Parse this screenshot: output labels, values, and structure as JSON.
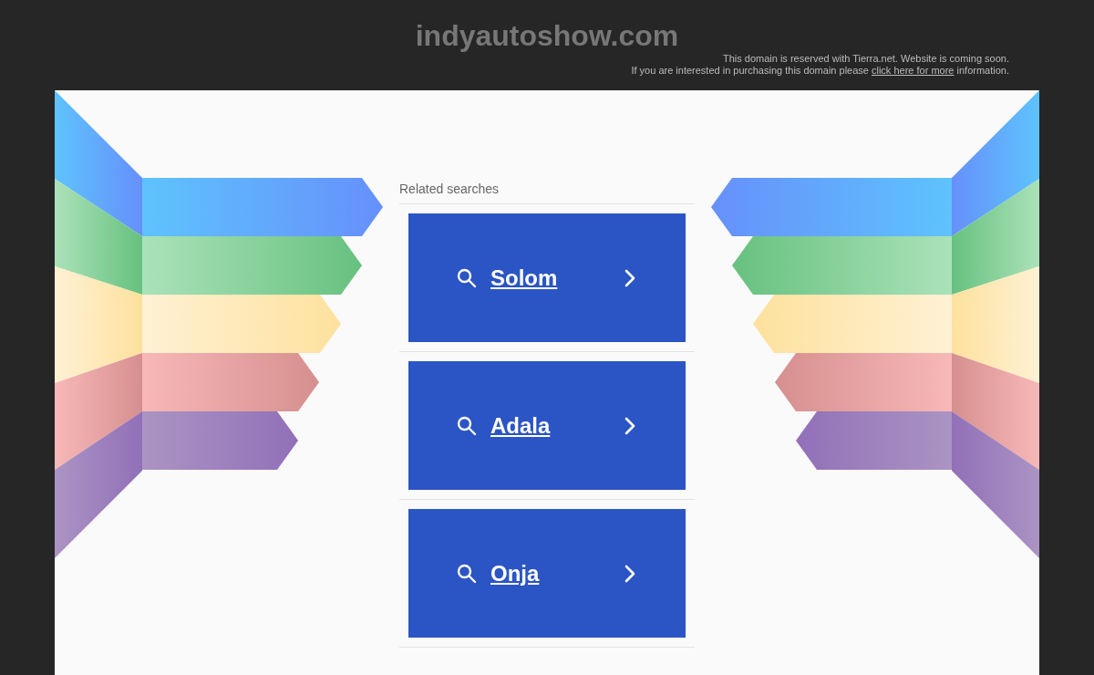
{
  "header": {
    "title": "indyautoshow.com",
    "notice_line_1": "This domain is reserved with Tierra.net. Website is coming soon.",
    "notice_line_2": {
      "before": "If you are interested in purchasing this domain please",
      "link": "click here for more",
      "after": "information."
    }
  },
  "related_searches": {
    "heading": "Related searches",
    "items": [
      {
        "label": "Solom"
      },
      {
        "label": "Adala"
      },
      {
        "label": "Onja"
      }
    ]
  }
}
